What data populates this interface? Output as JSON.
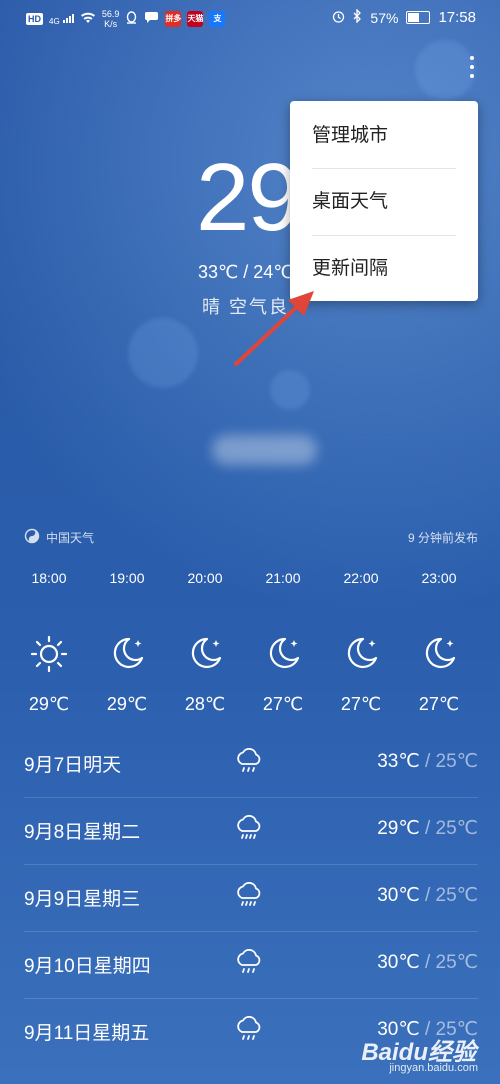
{
  "status_bar": {
    "hd": "HD",
    "net_gen": "4G",
    "speed_value": "56.9",
    "speed_unit": "K/s",
    "app_icon_1": "拼多",
    "app_icon_2": "天猫",
    "app_icon_3": "支",
    "battery": "57%",
    "time": "17:58",
    "icons": [
      "signal-icon",
      "wifi-icon",
      "qq-icon",
      "message-icon",
      "alarm-icon",
      "bluetooth-icon",
      "battery-icon"
    ]
  },
  "current": {
    "temp": "29",
    "range": "33℃ / 24℃",
    "condition": "晴  空气良"
  },
  "menu": {
    "items": [
      {
        "label": "管理城市"
      },
      {
        "label": "桌面天气"
      },
      {
        "label": "更新间隔"
      }
    ]
  },
  "source": {
    "name": "中国天气",
    "published": "9 分钟前发布"
  },
  "hourly": [
    {
      "time": "18:00",
      "icon": "sun-icon",
      "temp": "29℃"
    },
    {
      "time": "19:00",
      "icon": "moon-icon",
      "temp": "29℃"
    },
    {
      "time": "20:00",
      "icon": "moon-icon",
      "temp": "28℃"
    },
    {
      "time": "21:00",
      "icon": "moon-icon",
      "temp": "27℃"
    },
    {
      "time": "22:00",
      "icon": "moon-icon",
      "temp": "27℃"
    },
    {
      "time": "23:00",
      "icon": "moon-icon",
      "temp": "27℃"
    }
  ],
  "daily": [
    {
      "day": "9月7日明天",
      "icon": "rain-icon",
      "high": "33℃",
      "sep": " / ",
      "low": "25℃"
    },
    {
      "day": "9月8日星期二",
      "icon": "rain-icon",
      "high": "29℃",
      "sep": " / ",
      "low": "25℃"
    },
    {
      "day": "9月9日星期三",
      "icon": "rain-icon",
      "high": "30℃",
      "sep": " / ",
      "low": "25℃"
    },
    {
      "day": "9月10日星期四",
      "icon": "rain-icon",
      "high": "30℃",
      "sep": " / ",
      "low": "25℃"
    },
    {
      "day": "9月11日星期五",
      "icon": "rain-icon",
      "high": "30℃",
      "sep": " / ",
      "low": "25℃"
    }
  ],
  "watermark": {
    "brand": "Baidu经验",
    "url": "jingyan.baidu.com"
  },
  "colors": {
    "background": "#2a59a8",
    "arrow": "#e0453a",
    "menu_bg": "#ffffff"
  }
}
